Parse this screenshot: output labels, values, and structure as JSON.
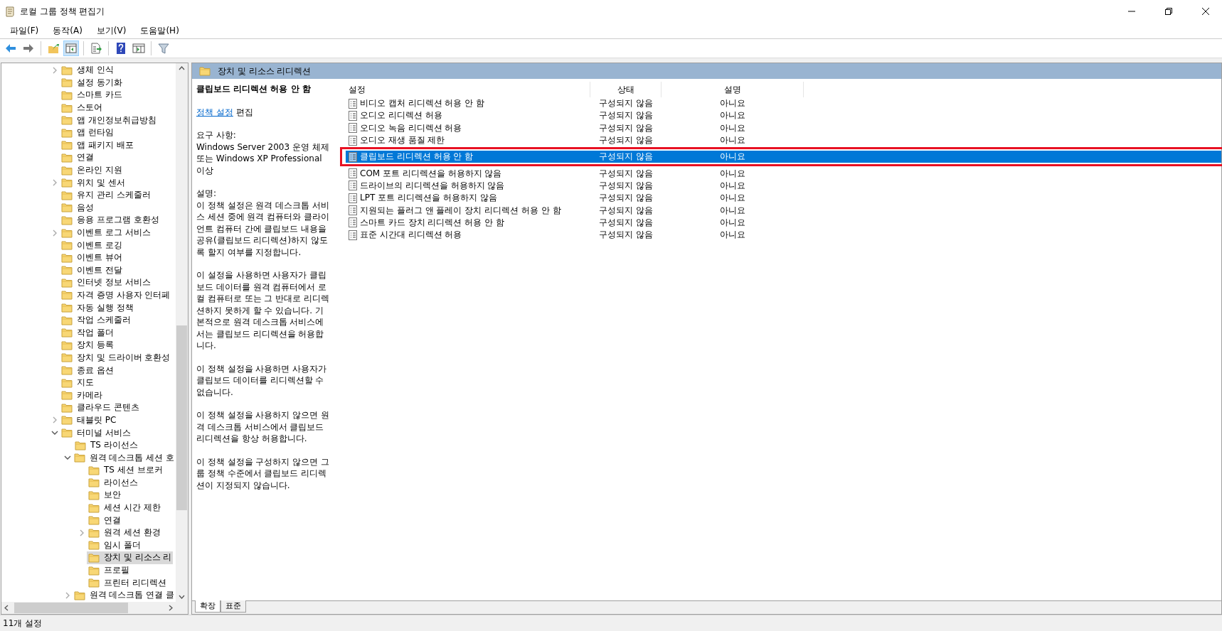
{
  "window": {
    "title": "로컬 그룹 정책 편집기"
  },
  "menu": [
    "파일(F)",
    "동작(A)",
    "보기(V)",
    "도움말(H)"
  ],
  "toolbar": [
    [
      {
        "kind": "back",
        "selected": false
      },
      {
        "kind": "forward",
        "selected": false
      }
    ],
    [
      {
        "kind": "up",
        "selected": false
      },
      {
        "kind": "tree",
        "selected": true
      }
    ],
    [
      {
        "kind": "export",
        "selected": false
      }
    ],
    [
      {
        "kind": "help",
        "selected": false
      },
      {
        "kind": "view",
        "selected": false
      }
    ],
    [
      {
        "kind": "filter",
        "selected": false
      }
    ]
  ],
  "tree": [
    {
      "label": "생체 인식",
      "expanded": false,
      "selected": false
    },
    {
      "label": "설정 동기화",
      "selected": false
    },
    {
      "label": "스마트 카드",
      "selected": false
    },
    {
      "label": "스토어",
      "selected": false
    },
    {
      "label": "앱 개인정보취급방침",
      "selected": false
    },
    {
      "label": "앱 런타임",
      "selected": false
    },
    {
      "label": "앱 패키지 배포",
      "selected": false
    },
    {
      "label": "연결",
      "selected": false
    },
    {
      "label": "온라인 지원",
      "selected": false
    },
    {
      "label": "위치 및 센서",
      "expanded": false,
      "selected": false
    },
    {
      "label": "유지 관리 스케줄러",
      "selected": false
    },
    {
      "label": "음성",
      "selected": false
    },
    {
      "label": "응용 프로그램 호환성",
      "selected": false
    },
    {
      "label": "이벤트 로그 서비스",
      "expanded": false,
      "selected": false
    },
    {
      "label": "이벤트 로깅",
      "selected": false
    },
    {
      "label": "이벤트 뷰어",
      "selected": false
    },
    {
      "label": "이벤트 전달",
      "selected": false
    },
    {
      "label": "인터넷 정보 서비스",
      "selected": false
    },
    {
      "label": "자격 증명 사용자 인터페",
      "selected": false
    },
    {
      "label": "자동 실행 정책",
      "selected": false
    },
    {
      "label": "작업 스케줄러",
      "selected": false
    },
    {
      "label": "작업 폴더",
      "selected": false
    },
    {
      "label": "장치 등록",
      "selected": false
    },
    {
      "label": "장치 및 드라이버 호환성",
      "selected": false
    },
    {
      "label": "종료 옵션",
      "selected": false
    },
    {
      "label": "지도",
      "selected": false
    },
    {
      "label": "카메라",
      "selected": false
    },
    {
      "label": "클라우드 콘텐츠",
      "selected": false
    },
    {
      "label": "태블릿 PC",
      "expanded": false,
      "selected": false
    },
    {
      "label": "터미널 서비스",
      "expanded": true,
      "selected": false,
      "children": [
        {
          "label": "TS 라이선스",
          "selected": false
        },
        {
          "label": "원격 데스크톱 세션 호",
          "expanded": true,
          "selected": false,
          "children": [
            {
              "label": "TS 세션 브로커",
              "selected": false
            },
            {
              "label": "라이선스",
              "selected": false
            },
            {
              "label": "보안",
              "selected": false
            },
            {
              "label": "세션 시간 제한",
              "selected": false
            },
            {
              "label": "연결",
              "selected": false
            },
            {
              "label": "원격 세션 환경",
              "expanded": false,
              "selected": false
            },
            {
              "label": "임시 폴더",
              "selected": false
            },
            {
              "label": "장치 및 리소스 리",
              "selected": true
            },
            {
              "label": "프로필",
              "selected": false
            },
            {
              "label": "프린터 리디렉션",
              "selected": false
            }
          ]
        },
        {
          "label": "원격 데스크톱 연결 클",
          "expanded": false,
          "selected": false
        }
      ]
    }
  ],
  "header": {
    "title": "장치 및 리소스 리디렉션"
  },
  "detail": {
    "title": "클립보드 리디렉션 허용 안 함",
    "link": "정책 설정",
    "link_after": " 편집",
    "requirements_label": "요구 사항:",
    "requirements": "Windows Server 2003 운영 체제 또는 Windows XP Professional 이상",
    "description_label": "설명:",
    "paragraphs": [
      "이 정책 설정은 원격 데스크톱 서비스 세션 중에 원격 컴퓨터와 클라이언트 컴퓨터 간에 클립보드 내용을 공유(클립보드 리디렉션)하지 않도록 할지 여부를 지정합니다.",
      "이 설정을 사용하면 사용자가 클립보드 데이터를 원격 컴퓨터에서 로컬 컴퓨터로 또는 그 반대로 리디렉션하지 못하게 할 수 있습니다. 기본적으로 원격 데스크톱 서비스에서는 클립보드 리디렉션을 허용합니다.",
      "이 정책 설정을 사용하면 사용자가 클립보드 데이터를 리디렉션할 수 없습니다.",
      "이 정책 설정을 사용하지 않으면 원격 데스크톱 서비스에서 클립보드 리디렉션을 항상 허용합니다.",
      "이 정책 설정을 구성하지 않으면 그룹 정책 수준에서 클립보드 리디렉션이 지정되지 않습니다."
    ]
  },
  "table": {
    "columns": [
      "설정",
      "상태",
      "설명"
    ],
    "rows": [
      {
        "name": "비디오 캡처 리디렉션 허용 안 함",
        "state": "구성되지 않음",
        "comment": "아니요",
        "selected": false,
        "framed": false
      },
      {
        "name": "오디오 리디렉션 허용",
        "state": "구성되지 않음",
        "comment": "아니요",
        "selected": false,
        "framed": false
      },
      {
        "name": "오디오 녹음 리디렉션 허용",
        "state": "구성되지 않음",
        "comment": "아니요",
        "selected": false,
        "framed": false
      },
      {
        "name": "오디오 재생 품질 제한",
        "state": "구성되지 않음",
        "comment": "아니요",
        "selected": false,
        "framed": false
      },
      {
        "name": "클립보드 리디렉션 허용 안 함",
        "state": "구성되지 않음",
        "comment": "아니요",
        "selected": true,
        "framed": true
      },
      {
        "name": "COM 포트 리디렉션을 허용하지 않음",
        "state": "구성되지 않음",
        "comment": "아니요",
        "selected": false,
        "framed": false
      },
      {
        "name": "드라이브의 리디렉션을 허용하지 않음",
        "state": "구성되지 않음",
        "comment": "아니요",
        "selected": false,
        "framed": false
      },
      {
        "name": "LPT 포트 리디렉션을 허용하지 않음",
        "state": "구성되지 않음",
        "comment": "아니요",
        "selected": false,
        "framed": false
      },
      {
        "name": "지원되는 플러그 앤 플레이 장치 리디렉션 허용 안 함",
        "state": "구성되지 않음",
        "comment": "아니요",
        "selected": false,
        "framed": false
      },
      {
        "name": "스마트 카드 장치 리디렉션 허용 안 함",
        "state": "구성되지 않음",
        "comment": "아니요",
        "selected": false,
        "framed": false
      },
      {
        "name": "표준 시간대 리디렉션 허용",
        "state": "구성되지 않음",
        "comment": "아니요",
        "selected": false,
        "framed": false
      }
    ]
  },
  "view_tabs": [
    {
      "label": "확장",
      "selected": true
    },
    {
      "label": "표준",
      "selected": false
    }
  ],
  "status_bar": "11개 설정"
}
